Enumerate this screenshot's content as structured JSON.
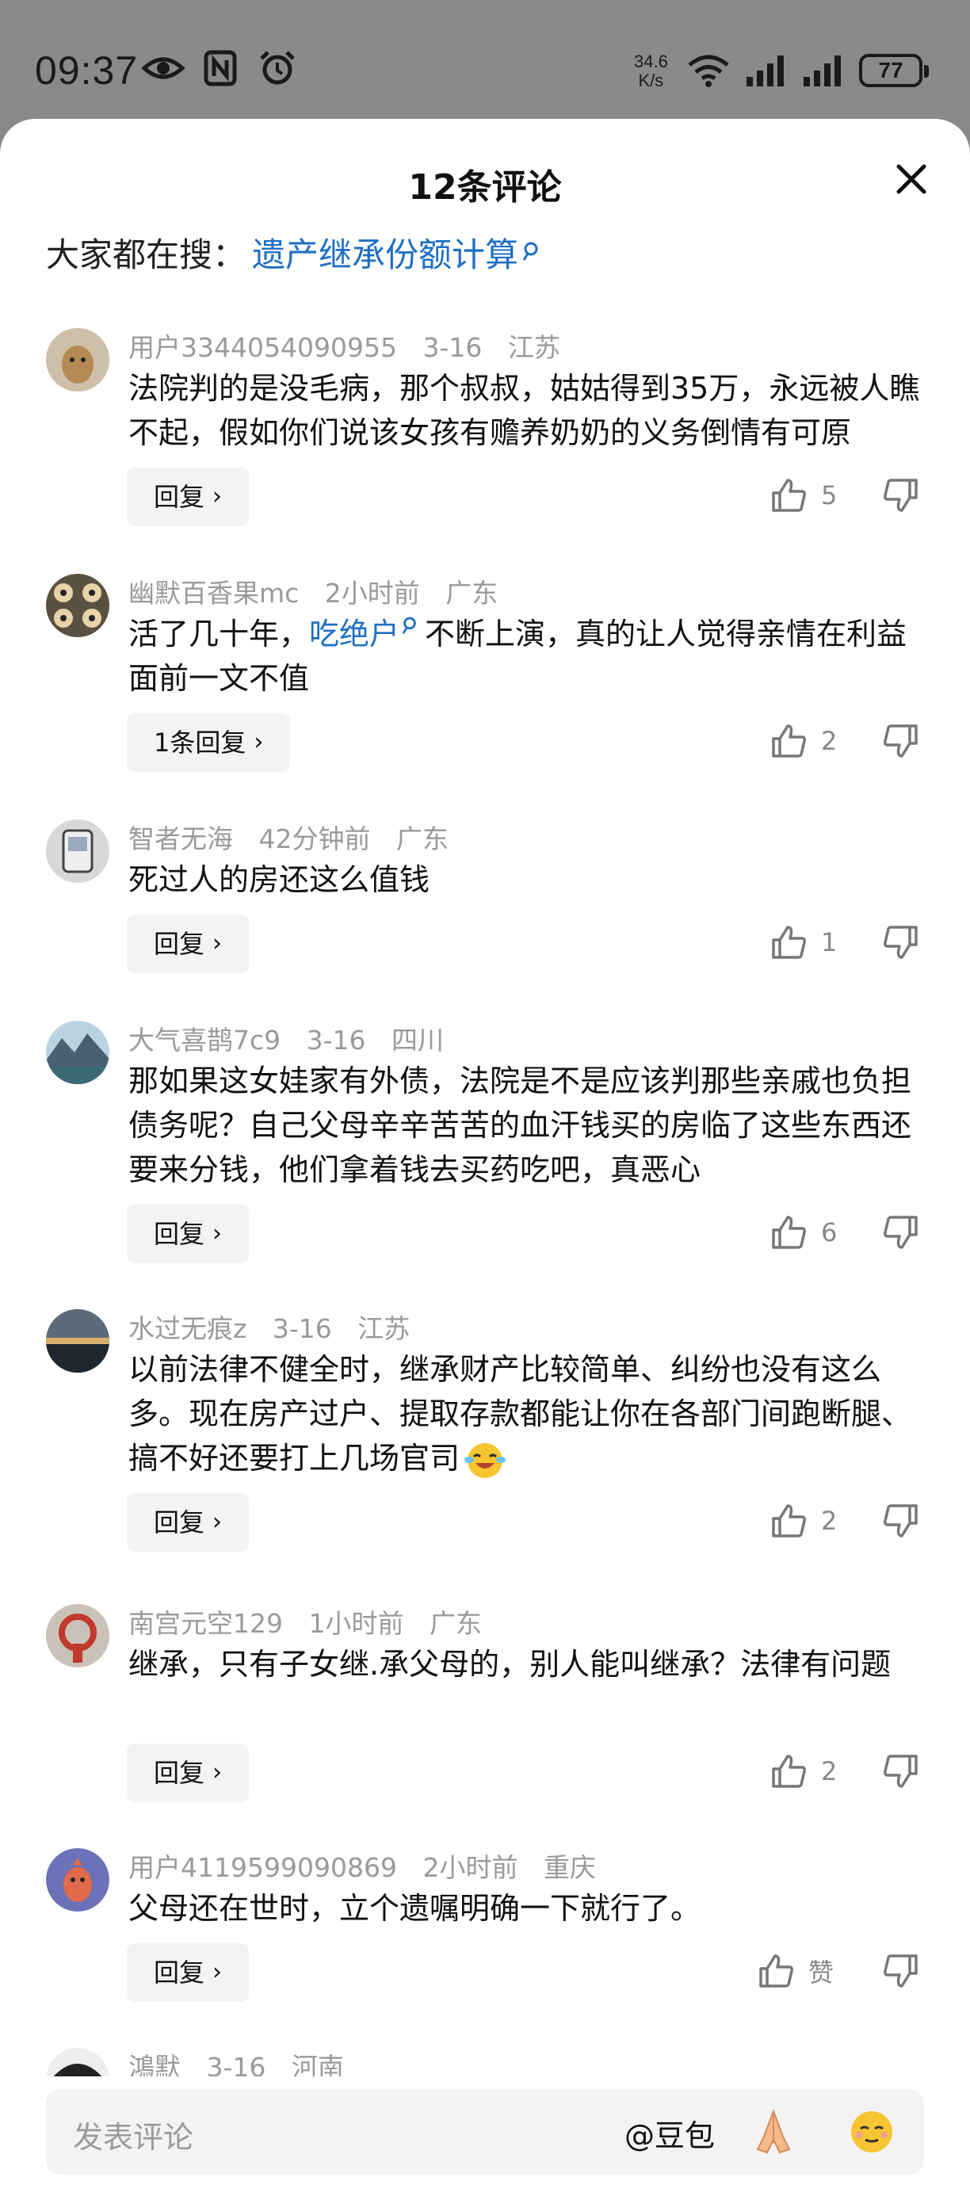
{
  "status": {
    "time": "09:37",
    "speed_value": "34.6",
    "speed_unit": "K/s",
    "battery": "77"
  },
  "sheet": {
    "title": "12条评论",
    "search_prefix": "大家都在搜：",
    "search_link": "遗产继承份额计算"
  },
  "comments": [
    {
      "user": "用户3344054090955",
      "time": "3-16",
      "region": "江苏",
      "text": "法院判的是没毛病，那个叔叔，姑姑得到35万，永远被人瞧不起，假如你们说该女孩有赡养奶奶的义务倒情有可原",
      "reply": "回复",
      "likes": "5"
    },
    {
      "user": "幽默百香果mc",
      "time": "2小时前",
      "region": "广东",
      "text_pre": "活了几十年，",
      "text_link": "吃绝户",
      "text_post": "不断上演，真的让人觉得亲情在利益面前一文不值",
      "reply": "1条回复",
      "likes": "2"
    },
    {
      "user": "智者无海",
      "time": "42分钟前",
      "region": "广东",
      "text": "死过人的房还这么值钱",
      "reply": "回复",
      "likes": "1"
    },
    {
      "user": "大气喜鹊7c9",
      "time": "3-16",
      "region": "四川",
      "text": "那如果这女娃家有外债，法院是不是应该判那些亲戚也负担债务呢？自己父母辛辛苦苦的血汗钱买的房临了这些东西还要来分钱，他们拿着钱去买药吃吧，真恶心",
      "reply": "回复",
      "likes": "6"
    },
    {
      "user": "水过无痕z",
      "time": "3-16",
      "region": "江苏",
      "text": "以前法律不健全时，继承财产比较简单、纠纷也没有这么多。现在房产过户、提取存款都能让你在各部门间跑断腿、搞不好还要打上几场官司",
      "reply": "回复",
      "likes": "2"
    },
    {
      "user": "南宫元空129",
      "time": "1小时前",
      "region": "广东",
      "text": "继承，只有子女继.承父母的，别人能叫继承？法律有问题",
      "reply": "回复",
      "likes": "2"
    },
    {
      "user": "用户4119599090869",
      "time": "2小时前",
      "region": "重庆",
      "text": "父母还在世时，立个遗嘱明确一下就行了。",
      "reply": "回复",
      "likes": "赞"
    },
    {
      "user": "鴻默",
      "time": "3-16",
      "region": "河南"
    }
  ],
  "input": {
    "placeholder": "发表评论",
    "mention": "@豆包"
  },
  "colors": {
    "link": "#1f6fc5",
    "meta": "#9a9a9a",
    "sheet_bg": "#ffffff",
    "overlay": "#8a8a8a"
  }
}
